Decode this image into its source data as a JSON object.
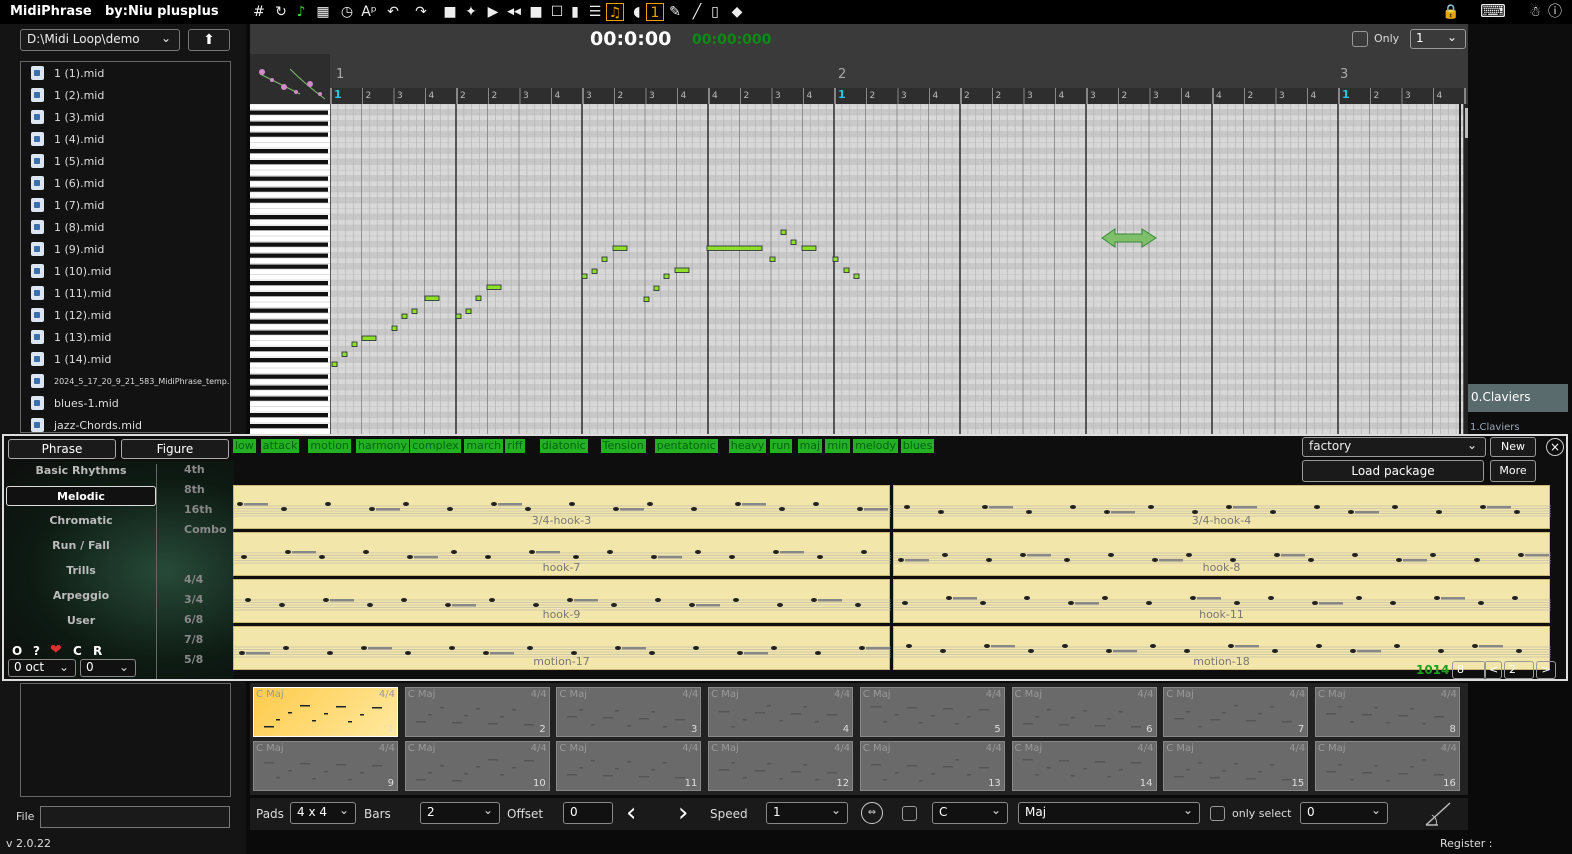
{
  "app": {
    "title": "MidiPhrase",
    "byline": "by:Niu plusplus",
    "version": "v 2.0.22",
    "register_label": "Register :"
  },
  "toolbar": {
    "icons": [
      "grid-icon",
      "redo-circle-icon",
      "note-icon",
      "pad-grid-icon",
      "clock-icon",
      "text-ap-icon",
      "undo-icon",
      "redo-icon",
      "record-icon",
      "paint-icon",
      "play-icon",
      "rewind-icon",
      "stop-icon",
      "checkbox-icon",
      "doc-icon",
      "list-icon",
      "metronome-icon",
      "speaker-icon",
      "one-icon",
      "pen-icon",
      "line-icon",
      "page-icon",
      "tag-icon"
    ],
    "right_icons": [
      "lock-icon",
      "keyboard-icon",
      "person-icon",
      "info-icon"
    ]
  },
  "browser": {
    "path": "D:\\Midi Loop\\demo",
    "files": [
      "1 (1).mid",
      "1 (2).mid",
      "1 (3).mid",
      "1 (4).mid",
      "1 (5).mid",
      "1 (6).mid",
      "1 (7).mid",
      "1 (8).mid",
      "1 (9).mid",
      "1 (10).mid",
      "1 (11).mid",
      "1 (12).mid",
      "1 (13).mid",
      "1 (14).mid",
      "2024_5_17_20_9_21_583_MidiPhrase_temp.mid",
      "blues-1.mid",
      "jazz-Chords.mid"
    ],
    "file_label": "File"
  },
  "transport": {
    "time": "00:0:00",
    "time_green": "00:00:000",
    "only_label": "Only",
    "only_value": "1"
  },
  "tracks": {
    "active": "0.Claviers",
    "next": "1.Claviers"
  },
  "ruler": {
    "bars": [
      "1",
      "2",
      "3"
    ],
    "beats": [
      "1",
      "2",
      "3",
      "4",
      "2",
      "2",
      "3",
      "4",
      "3",
      "2",
      "3",
      "4",
      "4",
      "2",
      "3",
      "4",
      "1",
      "2",
      "3",
      "4",
      "2",
      "2",
      "3",
      "4",
      "3",
      "2",
      "3",
      "4",
      "4",
      "2",
      "3",
      "4",
      "1",
      "2",
      "3",
      "4",
      "2"
    ]
  },
  "phrase_panel": {
    "tabs": [
      "Phrase",
      "Figure"
    ],
    "tags": [
      "low",
      "attack",
      "motion",
      "harmony",
      "complex",
      "march",
      "riff",
      "diatonic",
      "Tension",
      "pentatonic",
      "heavy",
      "run",
      "maj",
      "min",
      "melody",
      "blues"
    ],
    "categories": [
      "Basic Rhythms",
      "Melodic",
      "Chromatic",
      "Run / Fall",
      "Trills",
      "Arpeggio",
      "User"
    ],
    "selected_category": "Melodic",
    "meters": [
      "4th",
      "8th",
      "16th",
      "Combo",
      "4/4",
      "3/4",
      "6/8",
      "7/8",
      "5/8"
    ],
    "package": "factory",
    "new_label": "New",
    "load_label": "Load package",
    "more_label": "More",
    "close_label": "×",
    "controls": [
      "O",
      "?",
      "C",
      "R"
    ],
    "oct": "0 oct",
    "oct2": "0",
    "phrases": [
      "3/4-hook-3",
      "3/4-hook-4",
      "hook-7",
      "hook-8",
      "hook-9",
      "hook-11",
      "motion-17",
      "motion-18"
    ],
    "count": "1014",
    "page_size": "8",
    "page": "2",
    "prev": "<",
    "next": ">"
  },
  "pads": {
    "items": [
      {
        "key": "C Maj",
        "ts": "4/4",
        "num": "1"
      },
      {
        "key": "C Maj",
        "ts": "4/4",
        "num": "2"
      },
      {
        "key": "C Maj",
        "ts": "4/4",
        "num": "3"
      },
      {
        "key": "C Maj",
        "ts": "4/4",
        "num": "4"
      },
      {
        "key": "C Maj",
        "ts": "4/4",
        "num": "5"
      },
      {
        "key": "C Maj",
        "ts": "4/4",
        "num": "6"
      },
      {
        "key": "C Maj",
        "ts": "4/4",
        "num": "7"
      },
      {
        "key": "C Maj",
        "ts": "4/4",
        "num": "8"
      },
      {
        "key": "C Maj",
        "ts": "4/4",
        "num": "9"
      },
      {
        "key": "C Maj",
        "ts": "4/4",
        "num": "10"
      },
      {
        "key": "C Maj",
        "ts": "4/4",
        "num": "11"
      },
      {
        "key": "C Maj",
        "ts": "4/4",
        "num": "12"
      },
      {
        "key": "C Maj",
        "ts": "4/4",
        "num": "13"
      },
      {
        "key": "C Maj",
        "ts": "4/4",
        "num": "14"
      },
      {
        "key": "C Maj",
        "ts": "4/4",
        "num": "15"
      },
      {
        "key": "C Maj",
        "ts": "4/4",
        "num": "16"
      }
    ]
  },
  "bottom": {
    "pads_label": "Pads",
    "pads_value": "4 x 4",
    "bars_label": "Bars",
    "bars_value": "2",
    "offset_label": "Offset",
    "offset_value": "0",
    "speed_label": "Speed",
    "speed_value": "1",
    "key_value": "C",
    "scale_value": "Maj",
    "only_select_label": "only select",
    "last_value": "0"
  },
  "colors": {
    "note_green": "#8ee02a",
    "tag_green": "#23b023",
    "pad_active": "#ffcb4a",
    "card_bg": "#f3e6ab"
  }
}
